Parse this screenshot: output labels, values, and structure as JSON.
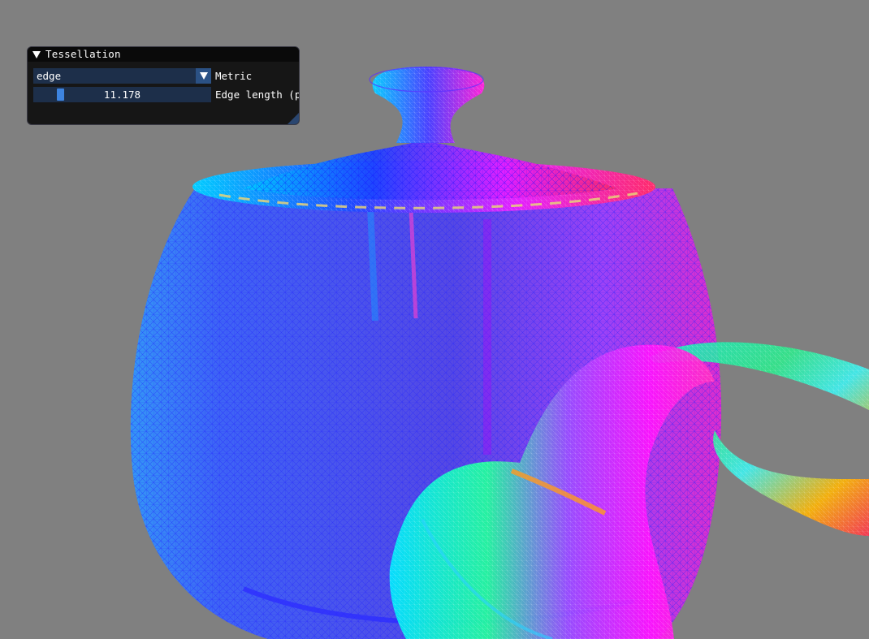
{
  "scene": {
    "background": "#808080",
    "model": "teapot-wireframe"
  },
  "tessellation_panel": {
    "title": "Tessellation",
    "metric_combo": {
      "value": "edge",
      "label": "Metric"
    },
    "edge_length_slider": {
      "value": "11.178",
      "label": "Edge length (px",
      "fill_fraction": 0.13
    }
  },
  "colors": {
    "panel_bg": "#0f0f0f",
    "frame_bg": "#1d2f4a",
    "accent": "#3d84e0",
    "button": "#2b5184"
  }
}
